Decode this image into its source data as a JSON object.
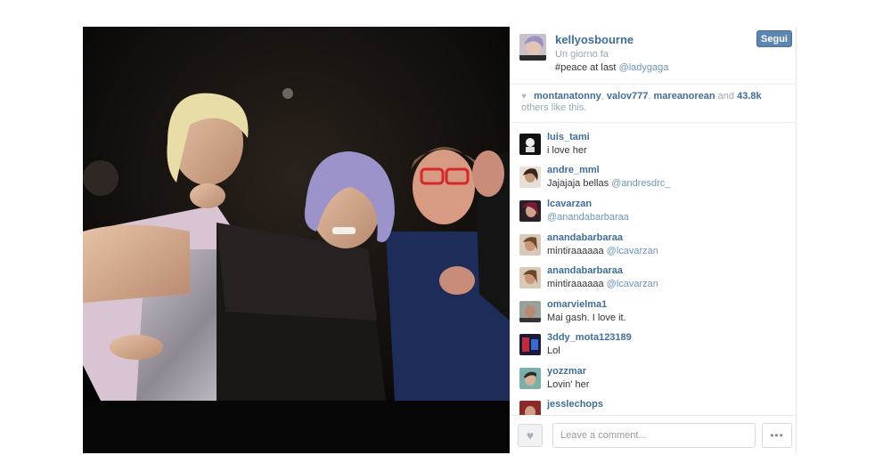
{
  "post": {
    "username": "kellyosbourne",
    "time": "Un giorno fa",
    "caption_text": "#peace at last",
    "caption_mention": "@ladygaga",
    "follow_label": "Segui"
  },
  "likes": {
    "user1": "montanatonny",
    "sep1": ",",
    "user2": "valov777",
    "sep2": ",",
    "user3": "mareanorean",
    "and_text": "and",
    "count": "43.8k",
    "others_text": "others like this."
  },
  "comments": [
    {
      "user": "luis_tami",
      "text": "i love her",
      "mention": ""
    },
    {
      "user": "andre_mml",
      "text": "Jajajaja bellas",
      "mention": "@andresdrc_"
    },
    {
      "user": "lcavarzan",
      "text": "",
      "mention": "@anandabarbaraa"
    },
    {
      "user": "anandabarbaraa",
      "text": "mintiraaaaaa",
      "mention": "@lcavarzan"
    },
    {
      "user": "anandabarbaraa",
      "text": "mintiraaaaaa",
      "mention": "@lcavarzan"
    },
    {
      "user": "omarvielma1",
      "text": "Mai gash. I love it.",
      "mention": ""
    },
    {
      "user": "3ddy_mota123189",
      "text": "Lol",
      "mention": ""
    },
    {
      "user": "yozzmar",
      "text": "Lovin' her",
      "mention": ""
    },
    {
      "user": "jesslechops",
      "text": "",
      "mention": ""
    }
  ],
  "footer": {
    "comment_placeholder": "Leave a comment...",
    "more_label": "•••",
    "like_icon": "heart-icon"
  },
  "colors": {
    "username": "#3f6e98",
    "follow_button": "#5b86b1",
    "mention": "#6b95b9",
    "meta": "#9aa8b4"
  }
}
